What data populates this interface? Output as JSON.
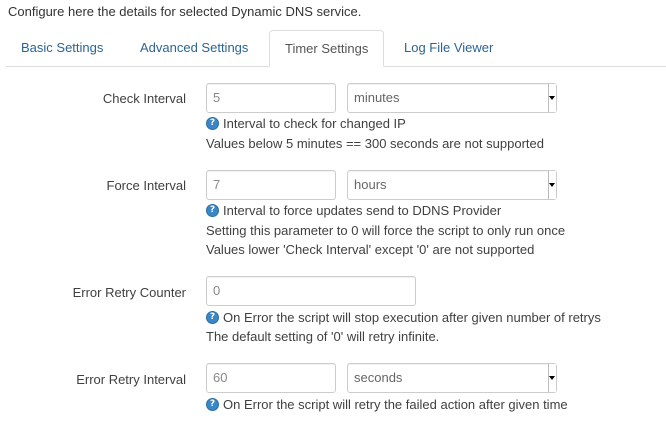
{
  "intro": "Configure here the details for selected Dynamic DNS service.",
  "tabs": [
    {
      "label": "Basic Settings",
      "active": false
    },
    {
      "label": "Advanced Settings",
      "active": false
    },
    {
      "label": "Timer Settings",
      "active": true
    },
    {
      "label": "Log File Viewer",
      "active": false
    }
  ],
  "check_interval": {
    "label": "Check Interval",
    "value": "5",
    "unit": "minutes",
    "help": "Interval to check for changed IP",
    "notes": [
      "Values below 5 minutes == 300 seconds are not supported"
    ]
  },
  "force_interval": {
    "label": "Force Interval",
    "value": "7",
    "unit": "hours",
    "help": "Interval to force updates send to DDNS Provider",
    "notes": [
      "Setting this parameter to 0 will force the script to only run once",
      "Values lower 'Check Interval' except '0' are not supported"
    ]
  },
  "retry_counter": {
    "label": "Error Retry Counter",
    "value": "0",
    "help": "On Error the script will stop execution after given number of retrys",
    "notes": [
      "The default setting of '0' will retry infinite."
    ]
  },
  "retry_interval": {
    "label": "Error Retry Interval",
    "value": "60",
    "unit": "seconds",
    "help": "On Error the script will retry the failed action after given time"
  },
  "colors": {
    "link": "#2a6496",
    "help_icon": "#3a87c8",
    "border": "#cccccc"
  },
  "icons": {
    "help": "help-circle-icon",
    "dropdown": "chevron-down-icon"
  }
}
